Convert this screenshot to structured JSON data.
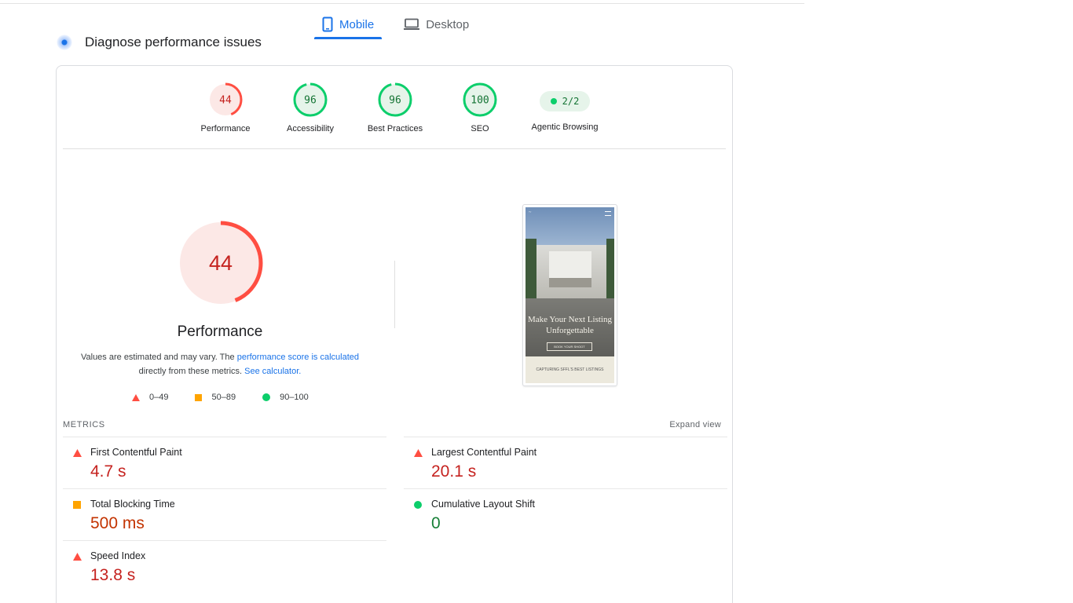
{
  "tabs": [
    {
      "label": "Mobile",
      "icon": "mobile-icon",
      "active": true
    },
    {
      "label": "Desktop",
      "icon": "desktop-icon",
      "active": false
    }
  ],
  "section_title": "Diagnose performance issues",
  "categories": [
    {
      "score": "44",
      "label": "Performance",
      "status": "fail",
      "fraction": 0.44
    },
    {
      "score": "96",
      "label": "Accessibility",
      "status": "pass",
      "fraction": 0.96
    },
    {
      "score": "96",
      "label": "Best Practices",
      "status": "pass",
      "fraction": 0.96
    },
    {
      "score": "100",
      "label": "SEO",
      "status": "pass",
      "fraction": 1.0
    },
    {
      "score": "2/2",
      "label": "Agentic Browsing",
      "status": "pass"
    }
  ],
  "performance": {
    "score": "44",
    "fraction": 0.44,
    "title": "Performance",
    "note_prefix": "Values are estimated and may vary. The ",
    "note_link1": "performance score is calculated",
    "note_middle": "directly from these metrics. ",
    "note_link2": "See calculator."
  },
  "legend": [
    {
      "shape": "triangle",
      "range": "0–49",
      "color": "#ff4e42"
    },
    {
      "shape": "square",
      "range": "50–89",
      "color": "#ffa400"
    },
    {
      "shape": "circle",
      "range": "90–100",
      "color": "#0cce6b"
    }
  ],
  "screenshot": {
    "headline_line1": "Make Your Next Listing",
    "headline_line2": "Unforgettable",
    "button": "BOOK YOUR SHOOT",
    "footer": "CAPTURING SFFL'S BEST LISTINGS"
  },
  "metrics_label": "METRICS",
  "expand_label": "Expand view",
  "metrics": [
    {
      "name": "First Contentful Paint",
      "value": "4.7 s",
      "status": "fail"
    },
    {
      "name": "Largest Contentful Paint",
      "value": "20.1 s",
      "status": "fail"
    },
    {
      "name": "Total Blocking Time",
      "value": "500 ms",
      "status": "average"
    },
    {
      "name": "Cumulative Layout Shift",
      "value": "0",
      "status": "pass"
    },
    {
      "name": "Speed Index",
      "value": "13.8 s",
      "status": "fail"
    }
  ],
  "colors": {
    "accent": "#1a73e8",
    "fail": "#ff4e42",
    "fail_text": "#c5221f",
    "fail_bg": "#fce8e6",
    "average": "#ffa400",
    "average_text": "#c33300",
    "pass": "#0cce6b",
    "pass_text": "#188038",
    "pass_bg": "#e6f4ea"
  }
}
